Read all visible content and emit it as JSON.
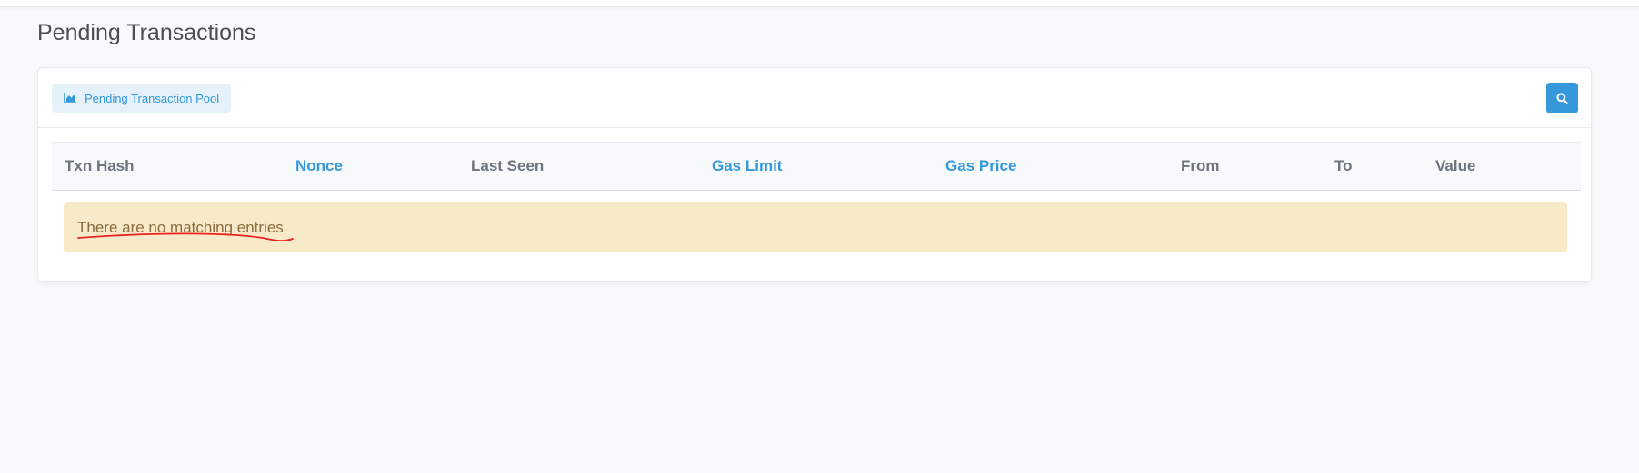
{
  "page": {
    "title": "Pending Transactions"
  },
  "toolbar": {
    "pool_button_label": "Pending Transaction Pool",
    "pool_icon": "area-chart-icon",
    "search_icon": "search-icon"
  },
  "table": {
    "columns": [
      "Txn Hash",
      "Nonce",
      "Last Seen",
      "Gas Limit",
      "Gas Price",
      "From",
      "To",
      "Value"
    ],
    "sortable_columns": [
      "Nonce",
      "Gas Limit",
      "Gas Price"
    ],
    "empty_message": "There are no matching entries"
  },
  "colors": {
    "accent": "#3498db",
    "header_text": "#6c757d",
    "alert_bg": "#f8e9c9",
    "alert_text": "#8a6d3b",
    "annotation": "#e8231d"
  }
}
